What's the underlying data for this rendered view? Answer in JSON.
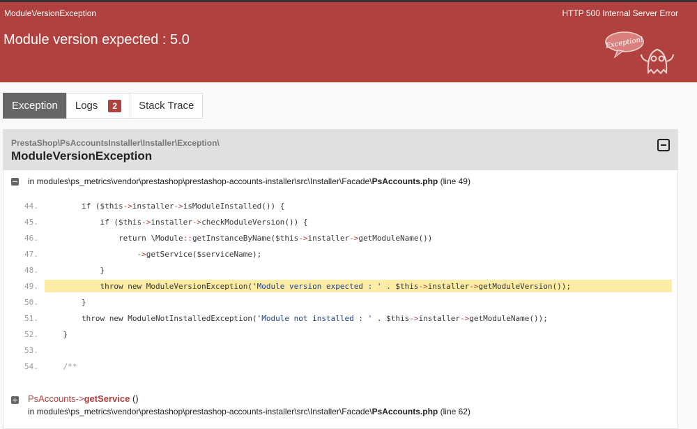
{
  "header": {
    "exception_class": "ModuleVersionException",
    "status": "HTTP 500 Internal Server Error",
    "message": "Module version expected : 5.0",
    "ghost_text": "Exception!"
  },
  "tabs": [
    {
      "label": "Exception",
      "active": true
    },
    {
      "label": "Logs",
      "badge": "2"
    },
    {
      "label": "Stack Trace"
    }
  ],
  "exception": {
    "namespace": "PrestaShop\\PsAccountsInstaller\\Installer\\Exception\\",
    "name": "ModuleVersionException",
    "location_prefix": "in modules\\ps_metrics\\vendor\\prestashop\\prestashop-accounts-installer\\src\\Installer\\Facade\\",
    "file": "PsAccounts.php",
    "line": "(line 49)"
  },
  "code": {
    "highlighted_line": "49",
    "lines": [
      {
        "n": "44.",
        "text": "        if ($this->installer->isModuleInstalled()) {"
      },
      {
        "n": "45.",
        "text": "            if ($this->installer->checkModuleVersion()) {"
      },
      {
        "n": "46.",
        "text": "                return \\Module::getInstanceByName($this->installer->getModuleName())"
      },
      {
        "n": "47.",
        "text": "                    ->getService($serviceName);"
      },
      {
        "n": "48.",
        "text": "            }"
      },
      {
        "n": "49.",
        "text": "            throw new ModuleVersionException('Module version expected : ' . $this->installer->getModuleVersion());"
      },
      {
        "n": "50.",
        "text": "        }"
      },
      {
        "n": "51.",
        "text": "        throw new ModuleNotInstalledException('Module not installed : ' . $this->installer->getModuleName());"
      },
      {
        "n": "52.",
        "text": "    }"
      },
      {
        "n": "53.",
        "text": ""
      },
      {
        "n": "54.",
        "text": "    /**"
      }
    ]
  },
  "next_frame": {
    "class": "PsAccounts",
    "arrow": "->",
    "method": "getService",
    "args": "()",
    "location_prefix": "in modules\\ps_metrics\\vendor\\prestashop\\prestashop-accounts-installer\\src\\Installer\\Facade\\",
    "file": "PsAccounts.php",
    "line": "(line 62)"
  },
  "colors": {
    "header_red": "#b0413e",
    "highlight": "#fdeca6",
    "active_tab": "#666666"
  }
}
